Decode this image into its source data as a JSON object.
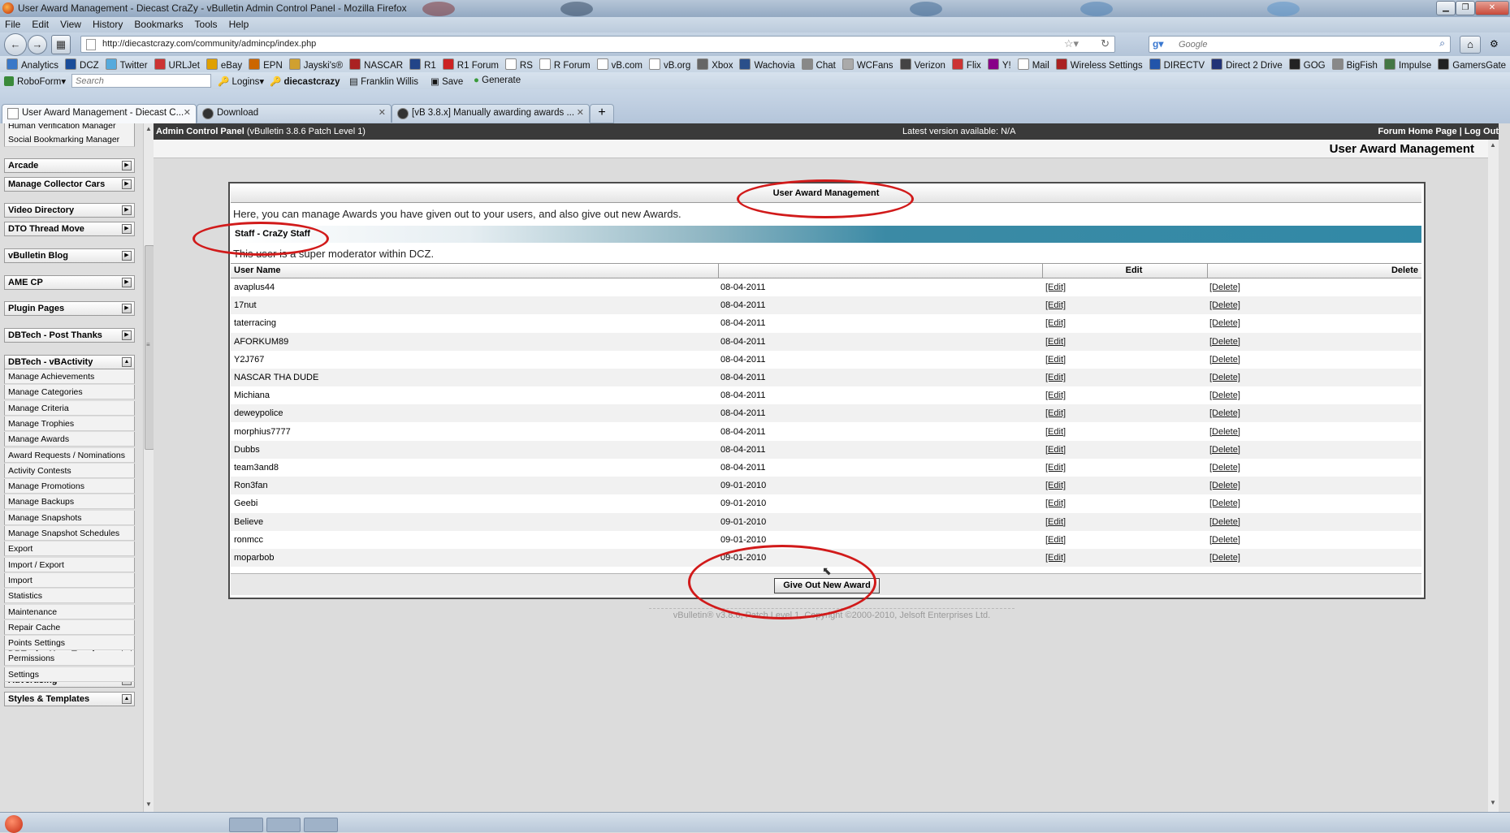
{
  "window": {
    "title": "User Award Management - Diecast CraZy - vBulletin Admin Control Panel - Mozilla Firefox"
  },
  "menu": [
    "File",
    "Edit",
    "View",
    "History",
    "Bookmarks",
    "Tools",
    "Help"
  ],
  "address": {
    "url": "http://diecastcrazy.com/community/admincp/index.php"
  },
  "search": {
    "placeholder": "Google"
  },
  "bookmarks": [
    "Analytics",
    "DCZ",
    "Twitter",
    "URLJet",
    "eBay",
    "EPN",
    "Jayski's®",
    "NASCAR",
    "R1",
    "R1 Forum",
    "RS",
    "R Forum",
    "vB.com",
    "vB.org",
    "Xbox",
    "Wachovia",
    "Chat",
    "WCFans",
    "Verizon",
    "Flix",
    "Y!",
    "Mail",
    "Wireless Settings",
    "DIRECTV",
    "Direct 2 Drive",
    "GOG",
    "BigFish",
    "Impulse",
    "GamersGate"
  ],
  "roboform": {
    "label": "RoboForm",
    "search_placeholder": "Search",
    "logins": "Logins",
    "site": "diecastcrazy",
    "person": "Franklin Willis",
    "save": "Save",
    "generate": "Generate"
  },
  "tabs": [
    {
      "label": "User Award Management - Diecast C..."
    },
    {
      "label": "Download"
    },
    {
      "label": "[vB 3.8.x] Manually awarding awards ..."
    }
  ],
  "sidebar": {
    "top_items": [
      "Human Verification Manager",
      "Social Bookmarking Manager"
    ],
    "sections": [
      "Arcade",
      "Manage Collector Cars",
      "Video Directory",
      "DTO Thread Move",
      "vBulletin Blog",
      "AME CP",
      "Plugin Pages",
      "DBTech - Post Thanks",
      "DBTech - vBActivity",
      "DBTech - User Tagging",
      "Advertising",
      "Styles & Templates"
    ],
    "vbactivity_items": [
      "Manage Achievements",
      "Manage Categories",
      "Manage Criteria",
      "Manage Trophies",
      "Manage Awards",
      "Award Requests / Nominations",
      "Activity Contests",
      "Manage Promotions",
      "Manage Backups",
      "Manage Snapshots",
      "Manage Snapshot Schedules",
      "Export",
      "Import / Export",
      "Import",
      "Statistics",
      "Maintenance",
      "Repair Cache",
      "Points Settings",
      "Permissions",
      "Settings"
    ]
  },
  "topstrip": {
    "left_bold": "Admin Control Panel",
    "left_rest": " (vBulletin 3.8.6 Patch Level 1)",
    "middle": "Latest version available: N/A",
    "forum_home": "Forum Home Page",
    "sep": " | ",
    "logout": "Log Out"
  },
  "page_title": "User Award Management",
  "panel": {
    "title": "User Award Management",
    "description": "Here, you can manage Awards you have given out to your users, and also give out new Awards.",
    "staff_label": "Staff - CraZy Staff",
    "note": "This user is a super moderator within DCZ.",
    "columns": {
      "user": "User Name",
      "date": "",
      "edit": "Edit",
      "delete": "Delete"
    },
    "edit_link": "[Edit]",
    "delete_link": "[Delete]",
    "rows": [
      {
        "user": "avaplus44",
        "date": "08-04-2011"
      },
      {
        "user": "17nut",
        "date": "08-04-2011"
      },
      {
        "user": "taterracing",
        "date": "08-04-2011"
      },
      {
        "user": "AFORKUM89",
        "date": "08-04-2011"
      },
      {
        "user": "Y2J767",
        "date": "08-04-2011"
      },
      {
        "user": "NASCAR THA DUDE",
        "date": "08-04-2011"
      },
      {
        "user": "Michiana",
        "date": "08-04-2011"
      },
      {
        "user": "deweypolice",
        "date": "08-04-2011"
      },
      {
        "user": "morphius7777",
        "date": "08-04-2011"
      },
      {
        "user": "Dubbs",
        "date": "08-04-2011"
      },
      {
        "user": "team3and8",
        "date": "08-04-2011"
      },
      {
        "user": "Ron3fan",
        "date": "09-01-2010"
      },
      {
        "user": "Geebi",
        "date": "09-01-2010"
      },
      {
        "user": "Believe",
        "date": "09-01-2010"
      },
      {
        "user": "ronmcc",
        "date": "09-01-2010"
      },
      {
        "user": "moparbob",
        "date": "09-01-2010"
      }
    ],
    "give_button": "Give Out New Award"
  },
  "copyright": "vBulletin® v3.8.6, Patch Level 1, Copyright ©2000-2010, Jelsoft Enterprises Ltd.",
  "colors": {
    "staff_bar": "#3189a6",
    "annotation": "#d11a1a",
    "top_strip": "#3a3a3a"
  }
}
